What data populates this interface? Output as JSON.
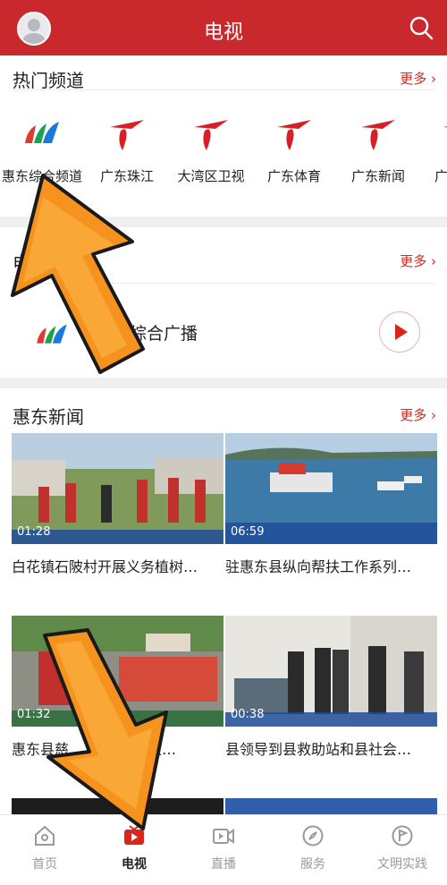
{
  "header": {
    "title": "电视"
  },
  "hot_channels": {
    "title": "热门频道",
    "more": "更多",
    "items": [
      {
        "label": "惠东综合频道"
      },
      {
        "label": "广东珠江"
      },
      {
        "label": "大湾区卫视"
      },
      {
        "label": "广东体育"
      },
      {
        "label": "广东新闻"
      },
      {
        "label": "广"
      }
    ]
  },
  "radio": {
    "title": "电",
    "more": "更多",
    "station": "东综合广播"
  },
  "news": {
    "title": "惠东新闻",
    "more": "更多",
    "items": [
      {
        "title": "白花镇石陂村开展义务植树…",
        "duration": "01:28"
      },
      {
        "title": "驻惠东县纵向帮扶工作系列…",
        "duration": "06:59"
      },
      {
        "title": "惠东县慈",
        "duration": "01:32",
        "title_tail": "助农…"
      },
      {
        "title": "县领导到县救助站和县社会…",
        "duration": "00:38"
      }
    ]
  },
  "tabbar": {
    "items": [
      {
        "label": "首页"
      },
      {
        "label": "电视"
      },
      {
        "label": "直播"
      },
      {
        "label": "服务"
      },
      {
        "label": "文明实践"
      }
    ]
  },
  "colors": {
    "brand": "#c9282d",
    "more": "#d9261c",
    "overlay_orange": "#f6921e"
  }
}
